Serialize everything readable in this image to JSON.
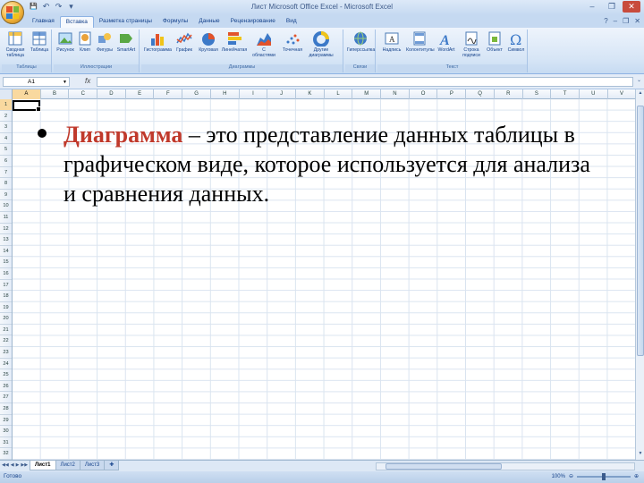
{
  "window": {
    "title": "Лист Microsoft Office Excel - Microsoft Excel",
    "controls": [
      "‒",
      "❐",
      "✕"
    ]
  },
  "quick_access": [
    "💾",
    "↶",
    "↷",
    "▾"
  ],
  "ribbon_tabs": [
    "Главная",
    "Вставка",
    "Разметка страницы",
    "Формулы",
    "Данные",
    "Рецензирование",
    "Вид"
  ],
  "active_tab": "Вставка",
  "ribbon_groups": [
    {
      "label": "Таблицы",
      "buttons": [
        "Сводная таблица",
        "Таблица"
      ]
    },
    {
      "label": "Иллюстрации",
      "buttons": [
        "Рисунок",
        "Клип",
        "Фигуры",
        "SmartArt"
      ]
    },
    {
      "label": "Диаграммы",
      "buttons": [
        "Гистограмма",
        "График",
        "Круговая",
        "Линейчатая",
        "С областями",
        "Точечная",
        "Другие диаграммы"
      ]
    },
    {
      "label": "Связи",
      "buttons": [
        "Гиперссылка"
      ]
    },
    {
      "label": "Текст",
      "buttons": [
        "Надпись",
        "Колонтитулы",
        "WordArt",
        "Строка подписи",
        "Объект",
        "Символ"
      ]
    }
  ],
  "formula_bar": {
    "name_box": "A1",
    "fx_label": "fx",
    "value": ""
  },
  "columns": [
    "A",
    "B",
    "C",
    "D",
    "E",
    "F",
    "G",
    "H",
    "I",
    "J",
    "K",
    "L",
    "M",
    "N",
    "O",
    "P",
    "Q",
    "R",
    "S",
    "T",
    "U",
    "V"
  ],
  "rows": [
    "1",
    "2",
    "3",
    "4",
    "5",
    "6",
    "7",
    "8",
    "9",
    "10",
    "11",
    "12",
    "13",
    "14",
    "15",
    "16",
    "17",
    "18",
    "19",
    "20",
    "21",
    "22",
    "23",
    "24",
    "25",
    "26",
    "27",
    "28",
    "29",
    "30",
    "31",
    "32"
  ],
  "selected_cell": "A1",
  "sheets": [
    "Лист1",
    "Лист2",
    "Лист3"
  ],
  "active_sheet": "Лист1",
  "status": {
    "text": "Готово",
    "zoom": "100%"
  },
  "slide_text": {
    "term": "Диаграмма",
    "definition": " – это представление данных таблицы в графическом виде, которое используется для анализа и сравнения данных."
  },
  "colors": {
    "term_color": "#c0392b",
    "ribbon": "#dbe8f7",
    "grid_line": "#dae4f0"
  }
}
